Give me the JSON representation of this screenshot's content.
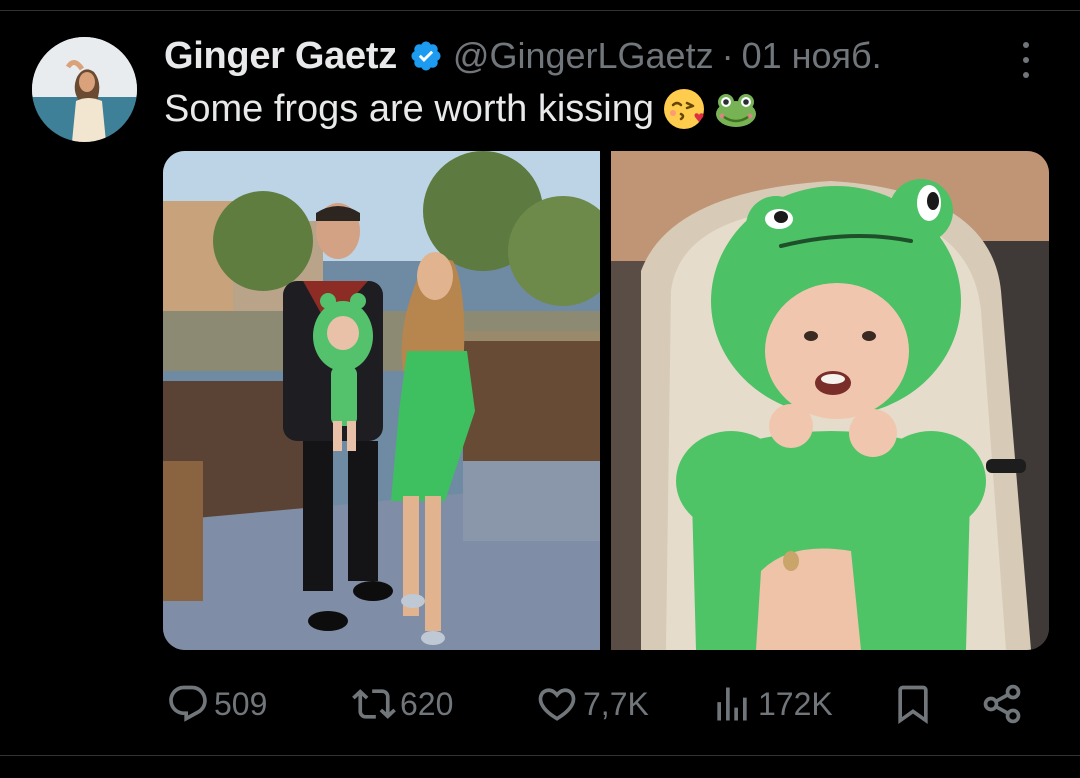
{
  "post": {
    "author_name": "Ginger Gaetz",
    "author_handle": "@GingerLGaetz",
    "separator": "·",
    "date": "01 нояб.",
    "text": "Some frogs are worth kissing"
  },
  "emojis": [
    "face-blowing-a-kiss-icon",
    "frog-face-icon"
  ],
  "stats": {
    "replies": "509",
    "reposts": "620",
    "likes": "7,7K",
    "views": "172K"
  },
  "colors": {
    "background": "#000000",
    "primary_text": "#e7e9ea",
    "secondary_text": "#71767b",
    "verified_badge": "#1d9bf0",
    "divider": "#2f3336"
  }
}
